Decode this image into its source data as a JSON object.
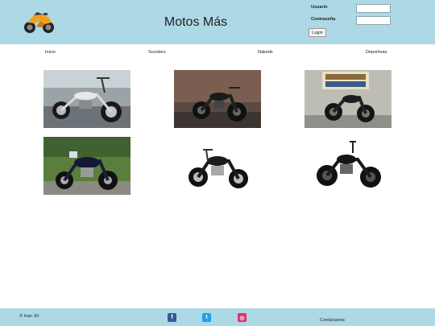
{
  "header": {
    "title": "Motos Más",
    "logo_icon": "motorcycle-logo-icon",
    "login": {
      "user_label": "Usuario",
      "password_label": "Contraseña",
      "user_value": "",
      "password_value": "",
      "button_label": "Login"
    }
  },
  "nav": {
    "items": [
      {
        "label": "Inicio"
      },
      {
        "label": "Scooters"
      },
      {
        "label": "Nakeds"
      },
      {
        "label": "Deportivas"
      }
    ]
  },
  "gallery": {
    "photos": [
      {
        "icon": "chopper-motorcycle-photo"
      },
      {
        "icon": "black-cruiser-photo"
      },
      {
        "icon": "showroom-cruiser-photo"
      },
      {
        "icon": "touring-cruiser-photo"
      },
      {
        "icon": "classic-cruiser-photo"
      },
      {
        "icon": "bobber-motorcycle-photo"
      }
    ]
  },
  "footer": {
    "copyright": "© Ivan JH",
    "social": [
      {
        "icon": "facebook-icon",
        "glyph": "f",
        "color": "#3b5998"
      },
      {
        "icon": "twitter-icon",
        "glyph": "t",
        "color": "#1da1f2"
      },
      {
        "icon": "instagram-icon",
        "glyph": "◎",
        "color": "#e1306c"
      }
    ],
    "contact_label": "Contáctanos"
  },
  "colors": {
    "header_bg": "#add8e6",
    "footer_bg": "#add8e6",
    "logo_orange": "#f0a020"
  }
}
